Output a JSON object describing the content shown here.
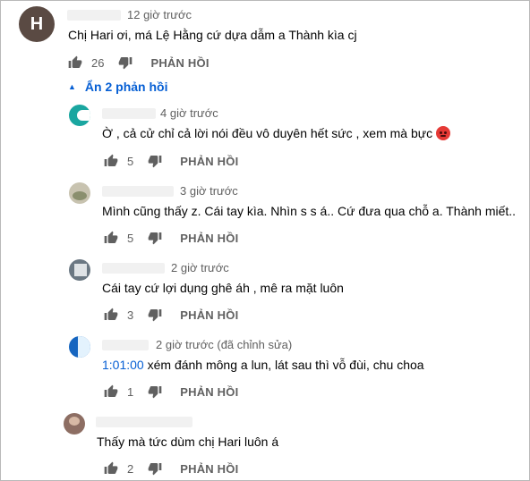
{
  "comments": [
    {
      "time": "12 giờ trước",
      "avatar_letter": "H",
      "text": "Chị Hari ơi, má Lệ Hằng cứ dựa dẫm a Thành kìa cj",
      "likes": "26",
      "reply_label": "PHẢN HỒI"
    }
  ],
  "toggle": {
    "arrow": "▲",
    "label": "Ẩn 2 phản hồi"
  },
  "replies": [
    {
      "time": "4 giờ trước",
      "text": "Ờ , cả cử chỉ cả lời nói đều vô duyên hết sức , xem mà bực",
      "emoji": "angry-face-emoji",
      "likes": "5",
      "reply_label": "PHẢN HỒI",
      "avatar_color": "#1aa6a0"
    },
    {
      "time": "3 giờ trước",
      "text": "Mình cũng thấy z. Cái tay kìa. Nhìn s s á.. Cứ đưa qua chỗ a. Thành miết..",
      "likes": "5",
      "reply_label": "PHẢN HỒI",
      "avatar_color": "#c8c3b0"
    },
    {
      "time": "2 giờ trước",
      "text": "Cái tay cứ lợi dụng ghê áh , mê ra mặt luôn",
      "likes": "3",
      "reply_label": "PHẢN HỒI",
      "avatar_color": "#6b7883"
    },
    {
      "time": "2 giờ trước (đã chỉnh sửa)",
      "timestamp_link": "1:01:00",
      "text": " xém đánh mông a lun, lát sau thì vỗ đùi, chu choa",
      "likes": "1",
      "reply_label": "PHẢN HỒI",
      "avatar_color": "#1565c0"
    },
    {
      "time": "",
      "text": "Thấy mà tức dùm chị Hari luôn á",
      "likes": "2",
      "reply_label": "PHẢN HỒI",
      "avatar_color": "#8d6e63"
    }
  ]
}
